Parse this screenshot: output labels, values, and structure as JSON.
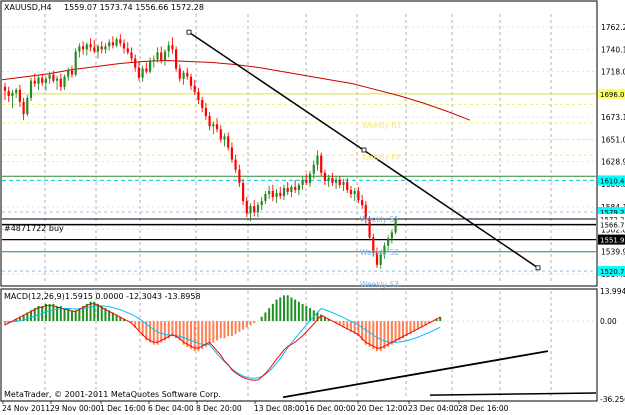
{
  "window": {
    "symbol_info": "XAUUSD,H4",
    "ohlc": "1559.07 1573.74 1556.66 1572.28"
  },
  "indicator": {
    "label": "MACD(12,26,9)",
    "values": "1.5915 0.0000 -12.3043 -13.8958"
  },
  "order_line": {
    "label": "#4871722 buy"
  },
  "levels": [
    {
      "label": "Weekly R1",
      "color": "#ffe680"
    },
    {
      "label": "Weekly PP",
      "color": "#ffe680"
    },
    {
      "label": "Weekly S1",
      "color": "#7fb2e5"
    },
    {
      "label": "Weekly S2",
      "color": "#7fb2e5"
    },
    {
      "label": "Weekly S3",
      "color": "#7fb2e5"
    }
  ],
  "price_axis": [
    "1762.20",
    "1740.10",
    "1718.00",
    "1695.90",
    "1673.15",
    "1651.05",
    "1628.95",
    "1606.85",
    "1584.10",
    "1562.00",
    "1539.90",
    "1517.80"
  ],
  "price_tags": [
    {
      "text": "1696.03",
      "bg": "#ffff66",
      "fg": "#000000"
    },
    {
      "text": "1610.47",
      "bg": "#00ffff",
      "fg": "#000000"
    },
    {
      "text": "1579.23",
      "bg": "#00ffff",
      "fg": "#000000"
    },
    {
      "text": "1572.28",
      "bg": "#ffffff",
      "fg": "#000000"
    },
    {
      "text": "1566.72",
      "bg": "#ffffff",
      "fg": "#000000"
    },
    {
      "text": "1551.91",
      "bg": "#000000",
      "fg": "#ffffff"
    },
    {
      "text": "1520.77",
      "bg": "#00ffff",
      "fg": "#000000"
    }
  ],
  "macd_axis": [
    "13.9944",
    "0.00",
    "-36.2565"
  ],
  "time_axis": [
    "24 Nov 2011",
    "29 Nov 00:00",
    "1 Dec 16:00",
    "6 Dec 04:00",
    "8 Dec 20:00",
    "13 Dec 08:00",
    "16 Dec 00:00",
    "20 Dec 12:00",
    "23 Dec 04:00",
    "28 Dec 16:00"
  ],
  "copyright": "MetaTrader, © 2001-2011 MetaQuotes Software Corp.",
  "colors": {
    "bull": "#228b22",
    "bear": "#ff0000",
    "grid": "#7f7f7f",
    "ma": "#cc0000",
    "trend": "#000000"
  },
  "chart_data": {
    "type": "candlestick",
    "title": "XAUUSD,H4",
    "ylim": [
      1508,
      1775
    ],
    "candles": [
      [
        1703,
        1707,
        1690,
        1699
      ],
      [
        1699,
        1703,
        1688,
        1694
      ],
      [
        1694,
        1700,
        1682,
        1697
      ],
      [
        1697,
        1702,
        1692,
        1700
      ],
      [
        1700,
        1705,
        1683,
        1688
      ],
      [
        1688,
        1692,
        1670,
        1676
      ],
      [
        1676,
        1695,
        1674,
        1692
      ],
      [
        1692,
        1712,
        1689,
        1709
      ],
      [
        1709,
        1716,
        1703,
        1706
      ],
      [
        1706,
        1714,
        1700,
        1712
      ],
      [
        1712,
        1716,
        1704,
        1707
      ],
      [
        1707,
        1713,
        1699,
        1711
      ],
      [
        1711,
        1718,
        1706,
        1715
      ],
      [
        1715,
        1719,
        1707,
        1709
      ],
      [
        1709,
        1714,
        1700,
        1711
      ],
      [
        1711,
        1716,
        1699,
        1703
      ],
      [
        1703,
        1715,
        1700,
        1713
      ],
      [
        1713,
        1722,
        1709,
        1719
      ],
      [
        1719,
        1724,
        1712,
        1715
      ],
      [
        1715,
        1741,
        1713,
        1738
      ],
      [
        1738,
        1746,
        1732,
        1743
      ],
      [
        1743,
        1748,
        1735,
        1740
      ],
      [
        1740,
        1747,
        1734,
        1745
      ],
      [
        1745,
        1751,
        1738,
        1742
      ],
      [
        1742,
        1749,
        1736,
        1738
      ],
      [
        1738,
        1745,
        1731,
        1743
      ],
      [
        1743,
        1748,
        1736,
        1740
      ],
      [
        1740,
        1746,
        1736,
        1743
      ],
      [
        1743,
        1750,
        1739,
        1747
      ],
      [
        1747,
        1753,
        1741,
        1744
      ],
      [
        1744,
        1752,
        1742,
        1750
      ],
      [
        1750,
        1755,
        1743,
        1746
      ],
      [
        1746,
        1750,
        1736,
        1741
      ],
      [
        1741,
        1747,
        1735,
        1737
      ],
      [
        1737,
        1742,
        1728,
        1731
      ],
      [
        1731,
        1735,
        1718,
        1722
      ],
      [
        1722,
        1728,
        1709,
        1712
      ],
      [
        1712,
        1724,
        1708,
        1721
      ],
      [
        1721,
        1727,
        1716,
        1718
      ],
      [
        1718,
        1732,
        1716,
        1728
      ],
      [
        1728,
        1734,
        1722,
        1730
      ],
      [
        1730,
        1742,
        1727,
        1737
      ],
      [
        1737,
        1743,
        1726,
        1729
      ],
      [
        1729,
        1740,
        1724,
        1738
      ],
      [
        1738,
        1748,
        1732,
        1744
      ],
      [
        1744,
        1752,
        1736,
        1740
      ],
      [
        1740,
        1743,
        1718,
        1721
      ],
      [
        1721,
        1725,
        1708,
        1711
      ],
      [
        1711,
        1719,
        1705,
        1717
      ],
      [
        1717,
        1722,
        1710,
        1713
      ],
      [
        1713,
        1716,
        1700,
        1704
      ],
      [
        1704,
        1710,
        1695,
        1698
      ],
      [
        1698,
        1702,
        1686,
        1690
      ],
      [
        1690,
        1693,
        1678,
        1682
      ],
      [
        1682,
        1687,
        1670,
        1674
      ],
      [
        1674,
        1678,
        1660,
        1664
      ],
      [
        1664,
        1669,
        1656,
        1666
      ],
      [
        1666,
        1672,
        1658,
        1661
      ],
      [
        1661,
        1665,
        1648,
        1651
      ],
      [
        1651,
        1657,
        1644,
        1654
      ],
      [
        1654,
        1658,
        1640,
        1643
      ],
      [
        1643,
        1648,
        1628,
        1631
      ],
      [
        1631,
        1636,
        1618,
        1621
      ],
      [
        1621,
        1626,
        1604,
        1608
      ],
      [
        1608,
        1612,
        1586,
        1590
      ],
      [
        1590,
        1594,
        1574,
        1578
      ],
      [
        1578,
        1588,
        1570,
        1585
      ],
      [
        1585,
        1591,
        1575,
        1579
      ],
      [
        1579,
        1589,
        1574,
        1586
      ],
      [
        1586,
        1594,
        1581,
        1590
      ],
      [
        1590,
        1600,
        1587,
        1597
      ],
      [
        1597,
        1605,
        1592,
        1600
      ],
      [
        1600,
        1606,
        1590,
        1594
      ],
      [
        1594,
        1602,
        1588,
        1598
      ],
      [
        1598,
        1604,
        1592,
        1595
      ],
      [
        1595,
        1606,
        1591,
        1603
      ],
      [
        1603,
        1609,
        1596,
        1599
      ],
      [
        1599,
        1606,
        1594,
        1604
      ],
      [
        1604,
        1611,
        1598,
        1601
      ],
      [
        1601,
        1608,
        1596,
        1606
      ],
      [
        1606,
        1614,
        1601,
        1611
      ],
      [
        1611,
        1617,
        1606,
        1608
      ],
      [
        1608,
        1620,
        1604,
        1617
      ],
      [
        1617,
        1630,
        1612,
        1626
      ],
      [
        1626,
        1640,
        1620,
        1635
      ],
      [
        1635,
        1638,
        1615,
        1618
      ],
      [
        1618,
        1621,
        1606,
        1610
      ],
      [
        1610,
        1616,
        1604,
        1613
      ],
      [
        1613,
        1618,
        1605,
        1608
      ],
      [
        1608,
        1614,
        1602,
        1611
      ],
      [
        1611,
        1615,
        1603,
        1606
      ],
      [
        1606,
        1612,
        1600,
        1609
      ],
      [
        1609,
        1613,
        1598,
        1601
      ],
      [
        1601,
        1605,
        1593,
        1597
      ],
      [
        1597,
        1603,
        1590,
        1600
      ],
      [
        1600,
        1604,
        1588,
        1591
      ],
      [
        1591,
        1596,
        1582,
        1586
      ],
      [
        1586,
        1590,
        1568,
        1572
      ],
      [
        1572,
        1575,
        1551,
        1554
      ],
      [
        1554,
        1558,
        1535,
        1539
      ],
      [
        1539,
        1544,
        1524,
        1527
      ],
      [
        1527,
        1540,
        1523,
        1537
      ],
      [
        1537,
        1549,
        1533,
        1546
      ],
      [
        1546,
        1556,
        1541,
        1553
      ],
      [
        1553,
        1562,
        1548,
        1559
      ],
      [
        1559,
        1574,
        1557,
        1572
      ]
    ],
    "moving_average": [
      1710,
      1713,
      1716,
      1720,
      1723,
      1726,
      1728,
      1729,
      1728,
      1727,
      1725,
      1722,
      1718,
      1714,
      1710,
      1706,
      1700,
      1694,
      1687,
      1679,
      1670
    ],
    "trendlines": [
      {
        "from_index": 44,
        "from_price": 1757,
        "to_index": 124,
        "to_price": 1524
      },
      {
        "from_index": 70,
        "from_value": -35.5,
        "to_index": 128,
        "to_value": -14
      }
    ],
    "horizontal_levels": [
      1696.03,
      1685.5,
      1667.3,
      1651.05,
      1635.4,
      1614.6,
      1610.47,
      1579.23,
      1572.28,
      1566.72,
      1551.91,
      1539.9,
      1520.77
    ],
    "macd": {
      "histogram": [
        -2,
        -1,
        0,
        1,
        2,
        3,
        4,
        5,
        6,
        7,
        7,
        8,
        8,
        8,
        7,
        7,
        6,
        6,
        5,
        5,
        6,
        7,
        8,
        9,
        9,
        8,
        7,
        6,
        5,
        4,
        3,
        2,
        1,
        0,
        -1,
        -3,
        -5,
        -7,
        -9,
        -10,
        -11,
        -11,
        -10,
        -9,
        -8,
        -7,
        -8,
        -9,
        -11,
        -12,
        -13,
        -14,
        -14,
        -13,
        -12,
        -11,
        -10,
        -9,
        -8,
        -8,
        -7,
        -7,
        -6,
        -5,
        -4,
        -3,
        -2,
        -1,
        0,
        2,
        4,
        6,
        8,
        10,
        11,
        12,
        12,
        11,
        10,
        9,
        8,
        7,
        6,
        5,
        4,
        3,
        2,
        1,
        0,
        -1,
        -2,
        -3,
        -4,
        -5,
        -6,
        -7,
        -9,
        -11,
        -12,
        -13,
        -14,
        -14,
        -13,
        -12,
        -11,
        -10,
        -9,
        -8,
        -7,
        -6,
        -5,
        -4,
        -3,
        -2,
        -1,
        0,
        1,
        2
      ],
      "signal_line_color": "#00bfff",
      "macd_line_color": "#ff0000"
    }
  }
}
